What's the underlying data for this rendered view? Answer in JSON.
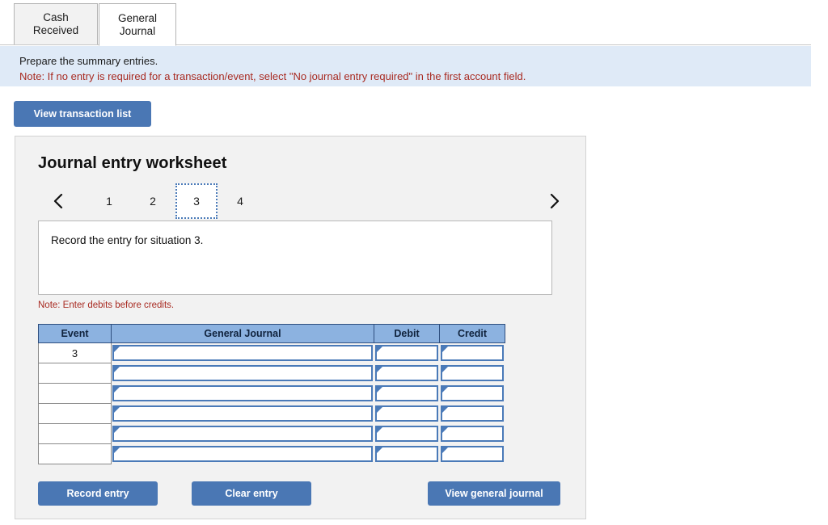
{
  "tabs": [
    {
      "label": "Cash Received",
      "active": false
    },
    {
      "label": "General Journal",
      "active": true
    }
  ],
  "banner": {
    "line1": "Prepare the summary entries.",
    "line2": "Note: If no entry is required for a transaction/event, select \"No journal entry required\" in the first account field."
  },
  "toolbar": {
    "view_transaction_list_label": "View transaction list"
  },
  "worksheet": {
    "title": "Journal entry worksheet",
    "pager": {
      "prev_icon": "chevron-left-icon",
      "next_icon": "chevron-right-icon",
      "pages": [
        "1",
        "2",
        "3",
        "4"
      ],
      "selected_page": "3"
    },
    "prompt": "Record the entry for situation 3.",
    "note": "Note: Enter debits before credits.",
    "table": {
      "headers": [
        "Event",
        "General Journal",
        "Debit",
        "Credit"
      ],
      "rows": [
        {
          "event": "3",
          "general_journal": "",
          "debit": "",
          "credit": ""
        },
        {
          "event": "",
          "general_journal": "",
          "debit": "",
          "credit": ""
        },
        {
          "event": "",
          "general_journal": "",
          "debit": "",
          "credit": ""
        },
        {
          "event": "",
          "general_journal": "",
          "debit": "",
          "credit": ""
        },
        {
          "event": "",
          "general_journal": "",
          "debit": "",
          "credit": ""
        },
        {
          "event": "",
          "general_journal": "",
          "debit": "",
          "credit": ""
        }
      ]
    },
    "buttons": {
      "record_entry": "Record entry",
      "clear_entry": "Clear entry",
      "view_general_journal": "View general journal"
    }
  },
  "colors": {
    "button_blue": "#4a77b4",
    "table_header_blue": "#8cb2e0",
    "banner_blue": "#dfeaf7",
    "note_red": "#a82a21",
    "panel_gray": "#f2f2f2",
    "input_border_blue": "#4a7ab8"
  }
}
